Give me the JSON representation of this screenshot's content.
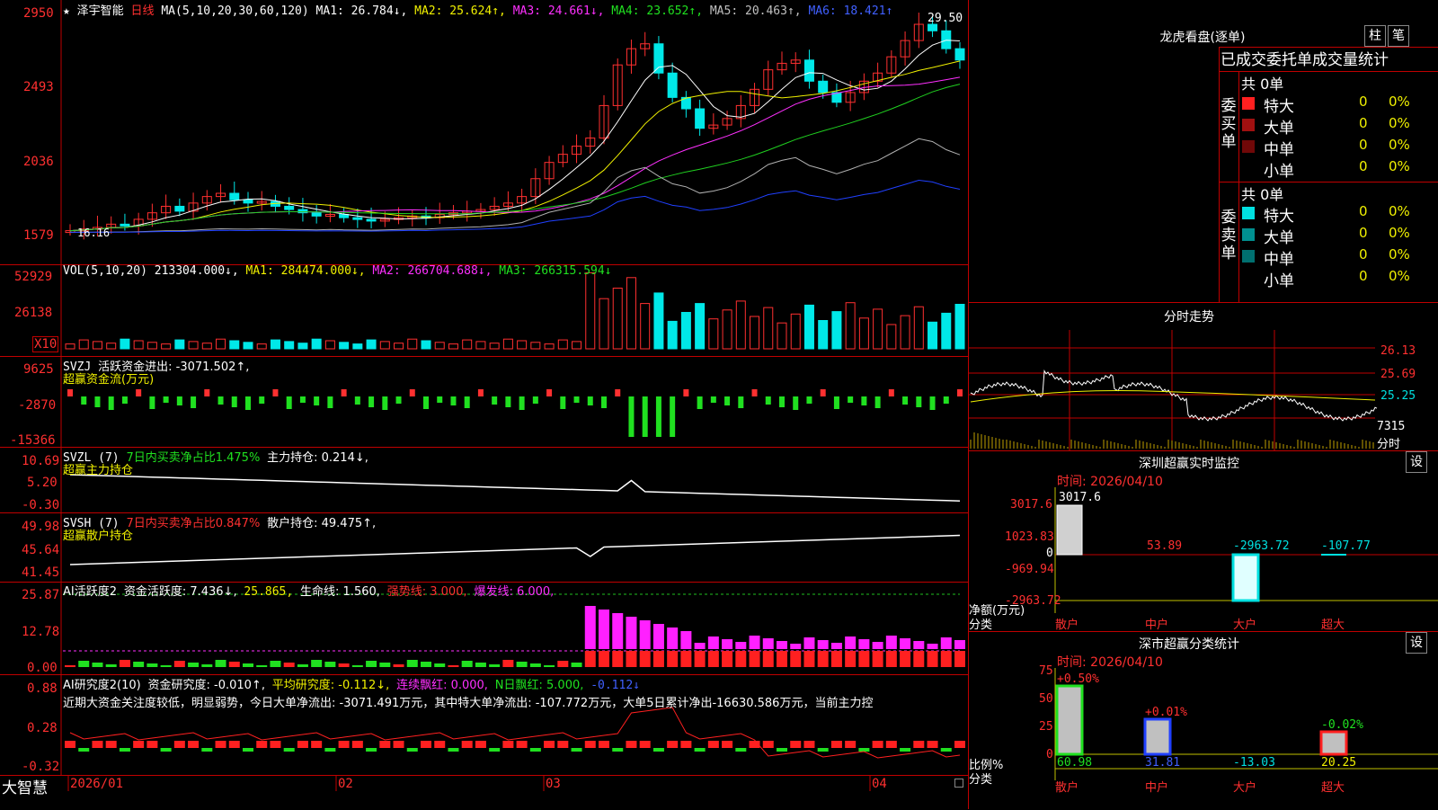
{
  "header": {
    "star": "★",
    "stock_name": "泽宇智能",
    "period": "日线",
    "ma_params": "MA(5,10,20,30,60,120)",
    "ma1": "MA1: 26.784↓,",
    "ma2": "MA2: 25.624↑,",
    "ma3": "MA3: 24.661↓,",
    "ma4": "MA4: 23.652↑,",
    "ma5": "MA5: 20.463↑,",
    "ma6": "MA6: 18.421↑"
  },
  "price_axis": [
    "2950",
    "2493",
    "2036",
    "1579"
  ],
  "price_high_label": "29.50",
  "price_low_label": "16.16",
  "vol_panel": {
    "title": "VOL(5,10,20)",
    "value": "213304.000↓,",
    "ma1": "MA1: 284474.000↓,",
    "ma2": "MA2: 266704.688↓,",
    "ma3": "MA3: 266315.594↓",
    "axis": [
      "52929",
      "26138"
    ],
    "unit": "X10"
  },
  "svzj_panel": {
    "title": "SVZJ",
    "line1": "活跃资金进出: -3071.502↑,",
    "line2": "超赢资金流(万元)",
    "axis": [
      "9625",
      "-2870",
      "-15366"
    ]
  },
  "svzl_panel": {
    "title": "SVZL (7)",
    "ratio": "7日内买卖净占比1.475%",
    "hold": "主力持仓: 0.214↓,",
    "line2": "超赢主力持仓",
    "axis": [
      "10.69",
      "5.20",
      "-0.30"
    ]
  },
  "svsh_panel": {
    "title": "SVSH (7)",
    "ratio": "7日内买卖净占比0.847%",
    "hold": "散户持仓: 49.475↑,",
    "line2": "超赢散户持仓",
    "axis": [
      "49.98",
      "45.64",
      "41.45"
    ]
  },
  "ai_active_panel": {
    "title": "AI活跃度2",
    "v1": "资金活跃度: 7.436↓,",
    "v2": "25.865,",
    "v3": "生命线: 1.560,",
    "v4": "强势线: 3.000,",
    "v5": "爆发线: 6.000,",
    "axis": [
      "25.87",
      "12.78",
      "0.00"
    ]
  },
  "ai_research_panel": {
    "title": "AI研究度2(10)",
    "v1": "资金研究度: -0.010↑,",
    "v2": "平均研究度: -0.112↓,",
    "v3": "连续飘红: 0.000,",
    "v4": "N日飘红: 5.000,",
    "v5": "-0.112↓",
    "summary": "近期大资金关注度较低，明显弱势，今日大单净流出: -3071.491万元，其中特大单净流出: -107.772万元，大单5日累计净出-16630.586万元，当前主力控",
    "axis": [
      "0.88",
      "0.28",
      "-0.32"
    ]
  },
  "date_axis": [
    "2026/01",
    "02",
    "03",
    "04"
  ],
  "brand": "大智慧",
  "right_top": {
    "title": "龙虎看盘(逐单)",
    "btn_zhu": "柱",
    "btn_bi": "笔",
    "tabs": "已成交委托单成交量统计",
    "buy_label": "委买单",
    "sell_label": "委卖单",
    "buy_total": "共 0单",
    "sell_total": "共 0单",
    "buy_rows": [
      {
        "name": "特大",
        "count": "0",
        "pct": "0%",
        "color": "#ff2020"
      },
      {
        "name": "大单",
        "count": "0",
        "pct": "0%",
        "color": "#a01010"
      },
      {
        "name": "中单",
        "count": "0",
        "pct": "0%",
        "color": "#700808"
      },
      {
        "name": "小单",
        "count": "0",
        "pct": "0%",
        "color": ""
      }
    ],
    "sell_rows": [
      {
        "name": "特大",
        "count": "0",
        "pct": "0%",
        "color": "#00e0e0"
      },
      {
        "name": "大单",
        "count": "0",
        "pct": "0%",
        "color": "#009090"
      },
      {
        "name": "中单",
        "count": "0",
        "pct": "0%",
        "color": "#007070"
      },
      {
        "name": "小单",
        "count": "0",
        "pct": "0%",
        "color": ""
      }
    ]
  },
  "intraday": {
    "title": "分时走势",
    "axis": [
      "26.13",
      "25.69",
      "25.25"
    ],
    "vol_label": "7315",
    "unit": "分时"
  },
  "monitor": {
    "title": "深圳超赢实时监控",
    "btn": "设",
    "time": "时间: 2026/04/10",
    "axis": [
      "3017.6",
      "1023.83",
      "0",
      "-969.94",
      "-2963.72"
    ],
    "ylabel": "净额(万元)",
    "xlabel": "分类",
    "categories": [
      "散户",
      "中户",
      "大户",
      "超大"
    ],
    "values": [
      "3017.6",
      "53.89",
      "-2963.72",
      "-107.77"
    ]
  },
  "classify": {
    "title": "深市超赢分类统计",
    "btn": "设",
    "time": "时间: 2026/04/10",
    "axis": [
      "75",
      "50",
      "25",
      "0"
    ],
    "ylabel": "比例%",
    "xlabel": "分类",
    "categories": [
      "散户",
      "中户",
      "大户",
      "超大"
    ],
    "top_labels": [
      "+0.50%",
      "+0.01%",
      "",
      "-0.02%"
    ],
    "values": [
      "60.98",
      "31.81",
      "-13.03",
      "20.25"
    ]
  }
}
